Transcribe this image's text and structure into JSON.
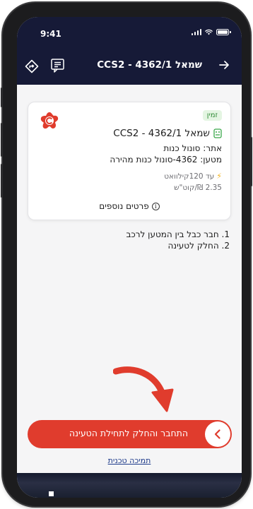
{
  "status_bar": {
    "time": "9:41"
  },
  "header": {
    "title": "שמאל CCS2 - 4362/1"
  },
  "card": {
    "badge": "זמין",
    "title": "שמאל CCS2 - 4362/1",
    "site": "אתר: סונול כנות",
    "charger": "מטען: 4362-סונול כנות מהירה",
    "power": "עד 120קילוואט",
    "price": "2.35 ₪/קוט\"ש",
    "more_details": "פרטים נוספים"
  },
  "steps": [
    "1. חבר כבל בין המטען לרכב",
    "2. החלק לטעינה"
  ],
  "cta": {
    "label": "התחבר והחלק לתחילת הטעינה"
  },
  "support_link": "תמיכה טכנית",
  "colors": {
    "header_bg": "#161a37",
    "accent_red": "#e03c2d",
    "available_green": "#2f8a35",
    "link_blue": "#1d3a8a"
  }
}
